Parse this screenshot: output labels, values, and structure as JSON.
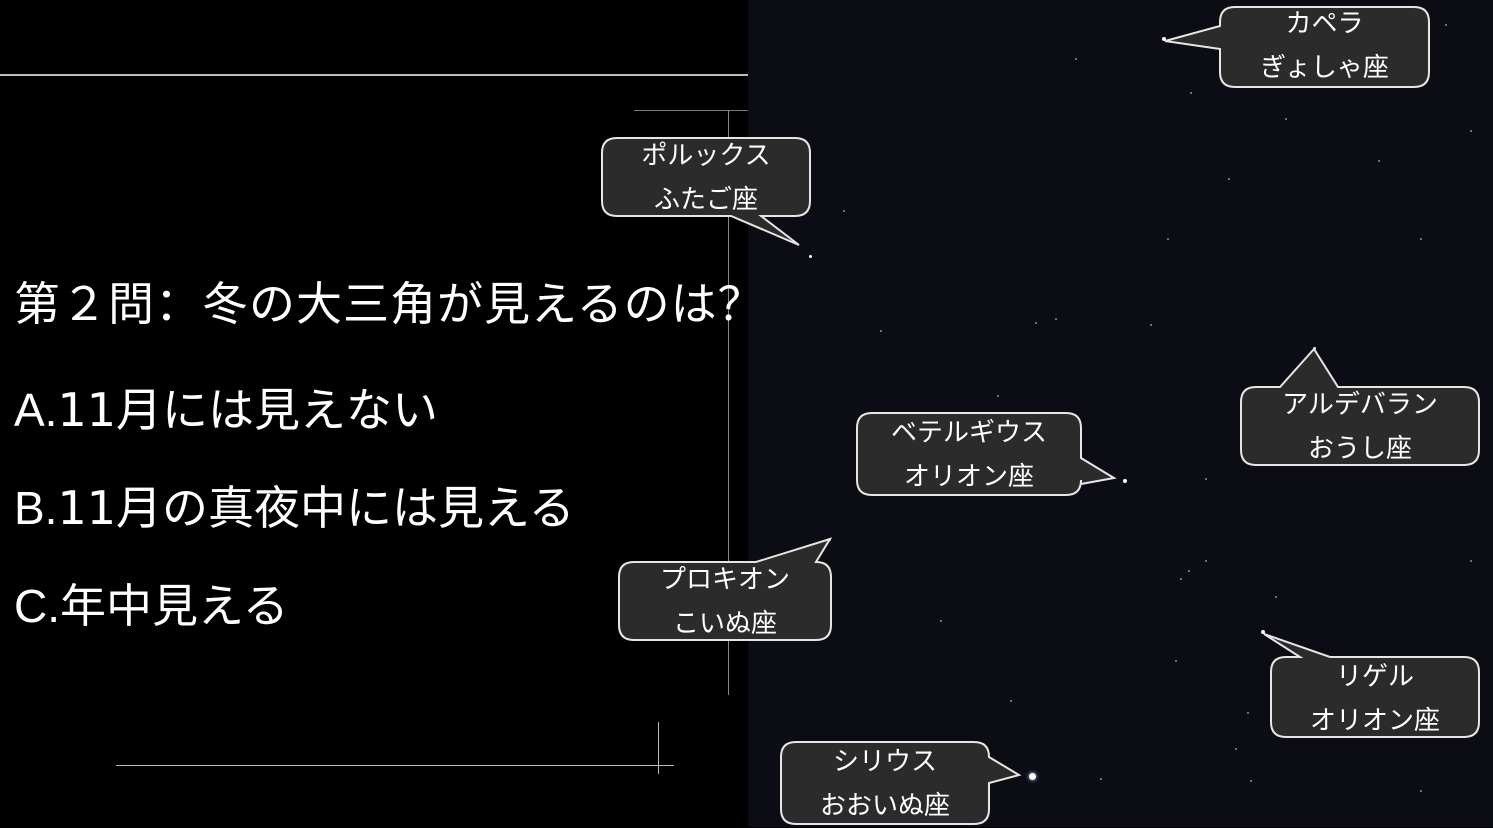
{
  "question": {
    "title": "第２問：冬の大三角が見えるのは？",
    "options": [
      {
        "key": "A.",
        "text": "11月には見えない"
      },
      {
        "key": "B.",
        "text": "11月の真夜中には見える"
      },
      {
        "key": "C.",
        "text": "年中見える"
      }
    ]
  },
  "stars": [
    {
      "name": "カペラ",
      "constellation": "ぎょしゃ座"
    },
    {
      "name": "ポルックス",
      "constellation": "ふたご座"
    },
    {
      "name": "アルデバラン",
      "constellation": "おうし座"
    },
    {
      "name": "ベテルギウス",
      "constellation": "オリオン座"
    },
    {
      "name": "プロキオン",
      "constellation": "こいぬ座"
    },
    {
      "name": "リゲル",
      "constellation": "オリオン座"
    },
    {
      "name": "シリウス",
      "constellation": "おおいぬ座"
    }
  ],
  "colors": {
    "background": "#000000",
    "sky": "#0b0c14",
    "callout_fill": "#2b2b2b",
    "callout_stroke": "#e6e6e6",
    "text": "#ffffff"
  }
}
